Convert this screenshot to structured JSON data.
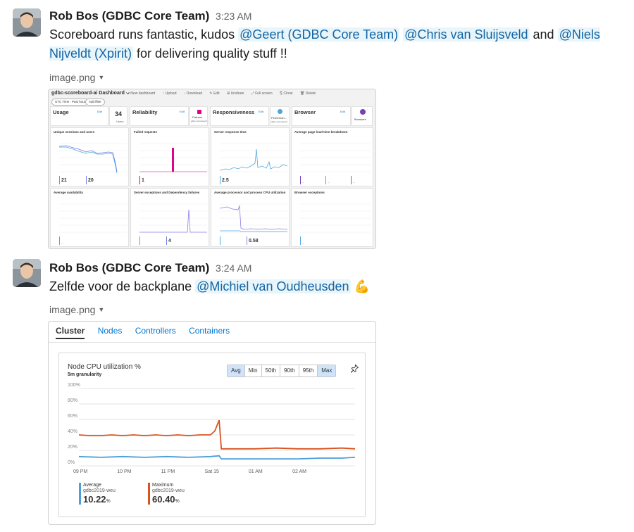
{
  "messages": [
    {
      "author": "Rob Bos (GDBC Core Team)",
      "time": "3:23 AM",
      "text_parts": [
        {
          "text": "Scoreboard runs fantastic, kudos "
        },
        {
          "mention": "@Geert (GDBC Core Team)"
        },
        {
          "text": " "
        },
        {
          "mention": "@Chris van Sluijsveld"
        },
        {
          "text": " and "
        },
        {
          "mention": "@Niels Nijveldt (Xpirit)"
        },
        {
          "text": " for delivering quality stuff !!"
        }
      ],
      "attachment": "image.png"
    },
    {
      "author": "Rob Bos (GDBC Core Team)",
      "time": "3:24 AM",
      "text_parts": [
        {
          "text": "Zelfde voor de backplane "
        },
        {
          "mention": "@Michiel van Oudheusden"
        },
        {
          "text": " "
        },
        {
          "emoji": "💪"
        }
      ],
      "attachment": "image.png"
    }
  ],
  "dashboard": {
    "title": "gdbc-scoreboard-ai Dashboard",
    "toolbar": [
      "+ New dashboard",
      "↑ Upload",
      "↓ Download",
      "✎ Edit",
      "⊞ Unshare",
      "⤢ Full screen",
      "⎘ Clone",
      "🗑 Delete"
    ],
    "filters": [
      "UTC Time : Past hour",
      "Add filter"
    ],
    "header_tiles": [
      {
        "title": "Usage",
        "edit": "Edit",
        "value": "34",
        "value_label": "Users"
      },
      {
        "title": "Reliability",
        "edit": "Edit",
        "value": "Failures",
        "value_label": "gdbc-scoreboard"
      },
      {
        "title": "Responsiveness",
        "edit": "Edit",
        "value": "Performan...",
        "value_label": "gdbc-scoreboard"
      },
      {
        "title": "Browser",
        "edit": "Edit",
        "value": "Browsers",
        "value_label": ""
      }
    ],
    "chart_tiles": [
      {
        "title": "Unique sessions and users",
        "values": [
          "21",
          "20"
        ]
      },
      {
        "title": "Failed requests",
        "values": [
          "1"
        ]
      },
      {
        "title": "Server response time",
        "values": [
          "2.5"
        ]
      },
      {
        "title": "Average page load time breakdown",
        "values": [
          "--",
          "--",
          "--"
        ]
      },
      {
        "title": "Average availability",
        "values": [
          "--"
        ]
      },
      {
        "title": "Server exceptions and Dependency failures",
        "values": [
          "4"
        ]
      },
      {
        "title": "Average processor and process CPU utilization",
        "values": [
          "0.58"
        ]
      },
      {
        "title": "Browser exceptions",
        "values": [
          "--"
        ]
      }
    ]
  },
  "cluster": {
    "tabs": [
      "Cluster",
      "Nodes",
      "Controllers",
      "Containers"
    ],
    "active_tab": "Cluster",
    "card_title": "Node CPU utilization %",
    "card_subtitle": "5m granularity",
    "aggregations": [
      "Avg",
      "Min",
      "50th",
      "90th",
      "95th",
      "Max"
    ],
    "selected_aggregations": [
      "Avg",
      "Max"
    ],
    "pin_icon": "pin-icon",
    "legend": [
      {
        "label": "Average",
        "source": "gdbc2019-weu",
        "value": "10.22",
        "unit": "%",
        "color": "#4a9fd8"
      },
      {
        "label": "Maximum",
        "source": "gdbc2019-weu",
        "value": "60.40",
        "unit": "%",
        "color": "#d9531e"
      }
    ]
  },
  "chart_data": {
    "type": "line",
    "title": "Node CPU utilization %",
    "subtitle": "5m granularity",
    "x_ticks": [
      "09 PM",
      "10 PM",
      "11 PM",
      "Sat 15",
      "01 AM",
      "02 AM"
    ],
    "y_ticks": [
      "100%",
      "80%",
      "60%",
      "40%",
      "20%",
      "0%"
    ],
    "ylim": [
      0,
      100
    ],
    "grid": true,
    "series": [
      {
        "name": "Maximum",
        "color": "#d9531e",
        "x": [
          0,
          0.25,
          0.5,
          0.75,
          1.0,
          1.25,
          1.5,
          1.75,
          2.0,
          2.25,
          2.5,
          2.75,
          3.0,
          3.1,
          3.2,
          3.25,
          3.5,
          4.0,
          4.5,
          5.0,
          5.5,
          6.0,
          6.3
        ],
        "y": [
          40,
          39,
          39,
          40,
          39,
          40,
          39,
          40,
          39,
          40,
          39,
          40,
          40,
          45,
          59,
          22,
          22,
          22,
          23,
          22,
          22,
          23,
          22
        ]
      },
      {
        "name": "Average",
        "color": "#4a9fd8",
        "x": [
          0,
          0.5,
          1.0,
          1.5,
          2.0,
          2.5,
          3.0,
          3.2,
          3.25,
          3.5,
          4.0,
          4.5,
          5.0,
          5.5,
          6.0,
          6.3
        ],
        "y": [
          12,
          11,
          12,
          11,
          12,
          11,
          12,
          13,
          9,
          9,
          9,
          9,
          9,
          10,
          10,
          11
        ]
      }
    ]
  }
}
